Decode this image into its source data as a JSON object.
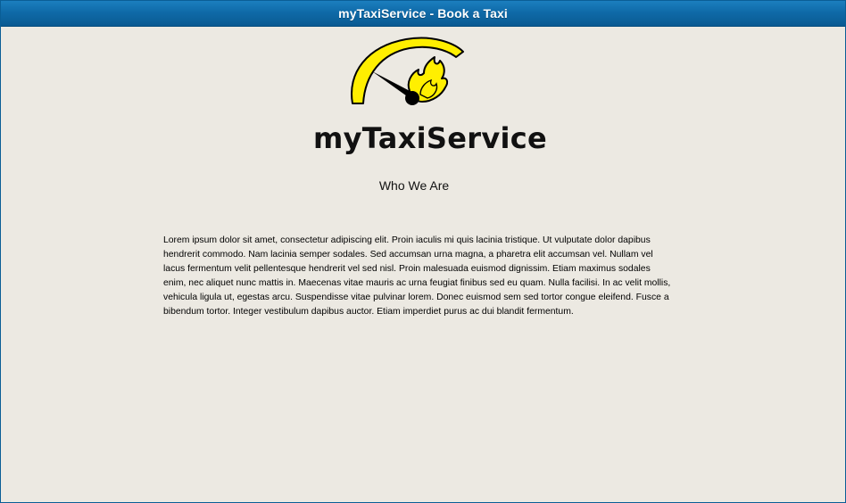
{
  "window": {
    "title": "myTaxiService - Book a Taxi"
  },
  "logo": {
    "brand_name": "myTaxiService",
    "icon": "speedometer-flame-icon",
    "colors": {
      "gauge": "#ffef00",
      "outline": "#000000",
      "flame": "#ffef00"
    }
  },
  "main": {
    "heading": "Who We Are",
    "body": "Lorem ipsum dolor sit amet, consectetur adipiscing elit. Proin iaculis mi quis lacinia tristique. Ut vulputate dolor dapibus hendrerit commodo. Nam lacinia semper sodales. Sed accumsan urna magna, a pharetra elit accumsan vel. Nullam vel lacus fermentum velit pellentesque hendrerit vel sed nisl. Proin malesuada euismod dignissim. Etiam maximus sodales enim, nec aliquet nunc mattis in. Maecenas vitae mauris ac urna feugiat finibus sed eu quam. Nulla facilisi. In ac velit mollis, vehicula ligula ut, egestas arcu. Suspendisse vitae pulvinar lorem. Donec euismod sem sed tortor congue eleifend. Fusce a bibendum tortor. Integer vestibulum dapibus auctor. Etiam imperdiet purus ac dui blandit fermentum."
  },
  "colors": {
    "titlebar": "#0f6aa8",
    "background": "#ece9e2",
    "text": "#000000"
  }
}
